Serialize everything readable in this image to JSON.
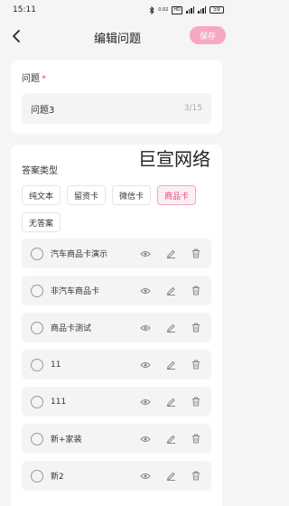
{
  "status_bar": {
    "time": "15:11",
    "speed": "0.02",
    "network": "HD",
    "signal1_label": "5G",
    "signal2_label": "5G",
    "battery": "59"
  },
  "nav": {
    "title": "编辑问题",
    "save_label": "保存"
  },
  "question": {
    "label": "问题",
    "required_mark": "*",
    "value": "问题3",
    "count": "3/15"
  },
  "watermark": "巨宣网络",
  "answer": {
    "label": "答案类型",
    "types": [
      {
        "label": "纯文本",
        "active": false
      },
      {
        "label": "留资卡",
        "active": false
      },
      {
        "label": "微信卡",
        "active": false
      },
      {
        "label": "商品卡",
        "active": true
      },
      {
        "label": "无答案",
        "active": false
      }
    ],
    "items": [
      {
        "text": "汽车商品卡演示"
      },
      {
        "text": "非汽车商品卡"
      },
      {
        "text": "商品卡测试"
      },
      {
        "text": "11"
      },
      {
        "text": "111"
      },
      {
        "text": "新+家装"
      },
      {
        "text": "新2"
      }
    ]
  },
  "colors": {
    "accent": "#e8467c",
    "save_bg": "#f8a7c3",
    "active_bg": "#fdeef3"
  }
}
